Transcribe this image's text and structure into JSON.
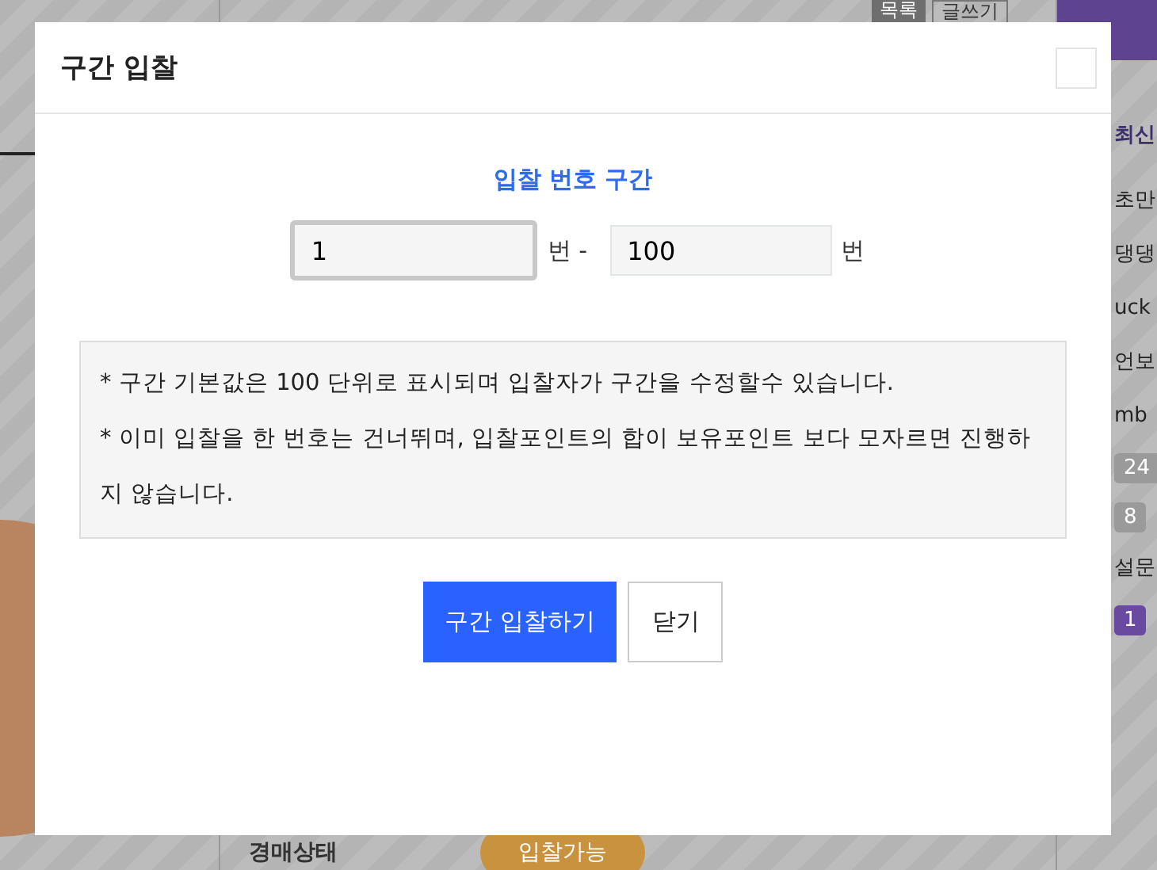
{
  "background": {
    "top_buttons": [
      {
        "label": "목록",
        "kind": "filled"
      },
      {
        "label": "글쓰기",
        "kind": "outline"
      }
    ],
    "sidebar_heading": "최신",
    "sidebar_items": [
      {
        "kind": "text",
        "label": "초만"
      },
      {
        "kind": "text",
        "label": "댕댕"
      },
      {
        "kind": "text",
        "label": "uck"
      },
      {
        "kind": "text",
        "label": "언보"
      },
      {
        "kind": "text",
        "label": "mb"
      },
      {
        "kind": "badge",
        "label": "24",
        "color": "#9a9a9a"
      },
      {
        "kind": "badge",
        "label": "8",
        "color": "#9a9a9a"
      },
      {
        "kind": "text",
        "label": "설문"
      },
      {
        "kind": "badge",
        "label": "1",
        "color": "#6a4aa0"
      }
    ],
    "status_label": "경매상태",
    "status_badge": "입찰가능"
  },
  "modal": {
    "title": "구간 입찰",
    "range_heading": "입찰 번호 구간",
    "inputs": [
      {
        "value": "1",
        "unit": "번 -",
        "focused": true
      },
      {
        "value": "100",
        "unit": "번",
        "focused": false
      }
    ],
    "notice": [
      "* 구간 기본값은 100 단위로 표시되며 입찰자가 구간을 수정할수 있습니다.",
      "* 이미 입찰을 한 번호는 건너뛰며, 입찰포인트의 합이 보유포인트 보다 모자르면 진행하지 않습니다."
    ],
    "buttons": [
      {
        "label": "구간 입찰하기",
        "kind": "primary"
      },
      {
        "label": "닫기",
        "kind": "secondary"
      }
    ]
  }
}
